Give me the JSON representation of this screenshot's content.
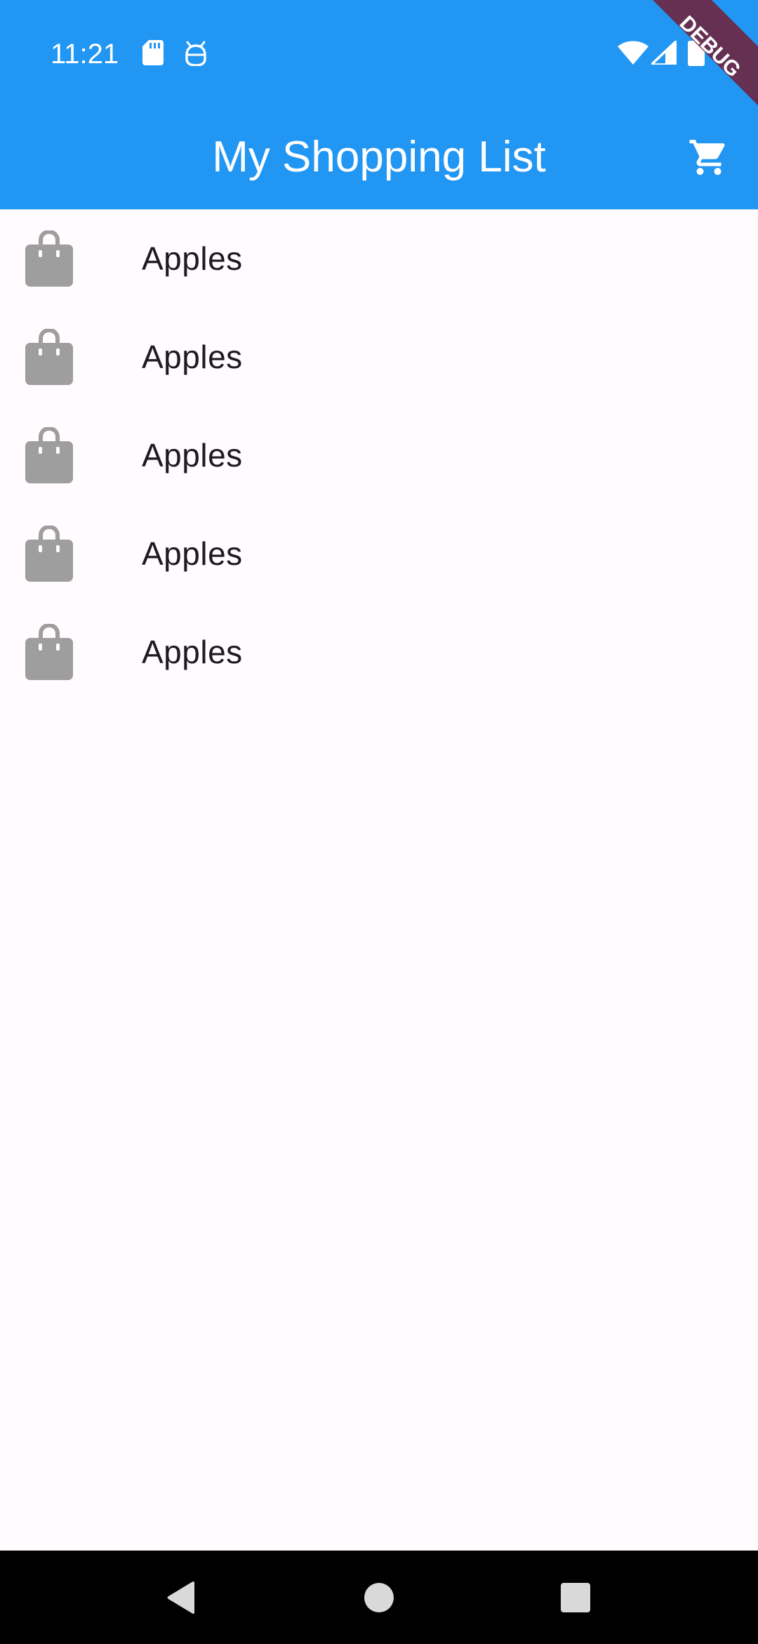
{
  "status_bar": {
    "time": "11:21",
    "icons": [
      "sd-card-icon",
      "android-debug-icon",
      "wifi-icon",
      "signal-icon",
      "battery-icon"
    ]
  },
  "app_bar": {
    "title": "My Shopping List",
    "action_icon": "shopping-cart-icon",
    "background": "#2196F3"
  },
  "list": {
    "items": [
      {
        "label": "Apples",
        "icon": "shopping-bag-icon"
      },
      {
        "label": "Apples",
        "icon": "shopping-bag-icon"
      },
      {
        "label": "Apples",
        "icon": "shopping-bag-icon"
      },
      {
        "label": "Apples",
        "icon": "shopping-bag-icon"
      },
      {
        "label": "Apples",
        "icon": "shopping-bag-icon"
      }
    ],
    "icon_color": "#9E9E9E"
  },
  "debug_banner": {
    "label": "DEBUG",
    "color": "#6D2745"
  },
  "nav_bar": {
    "buttons": [
      "back-icon",
      "home-icon",
      "recents-icon"
    ]
  }
}
